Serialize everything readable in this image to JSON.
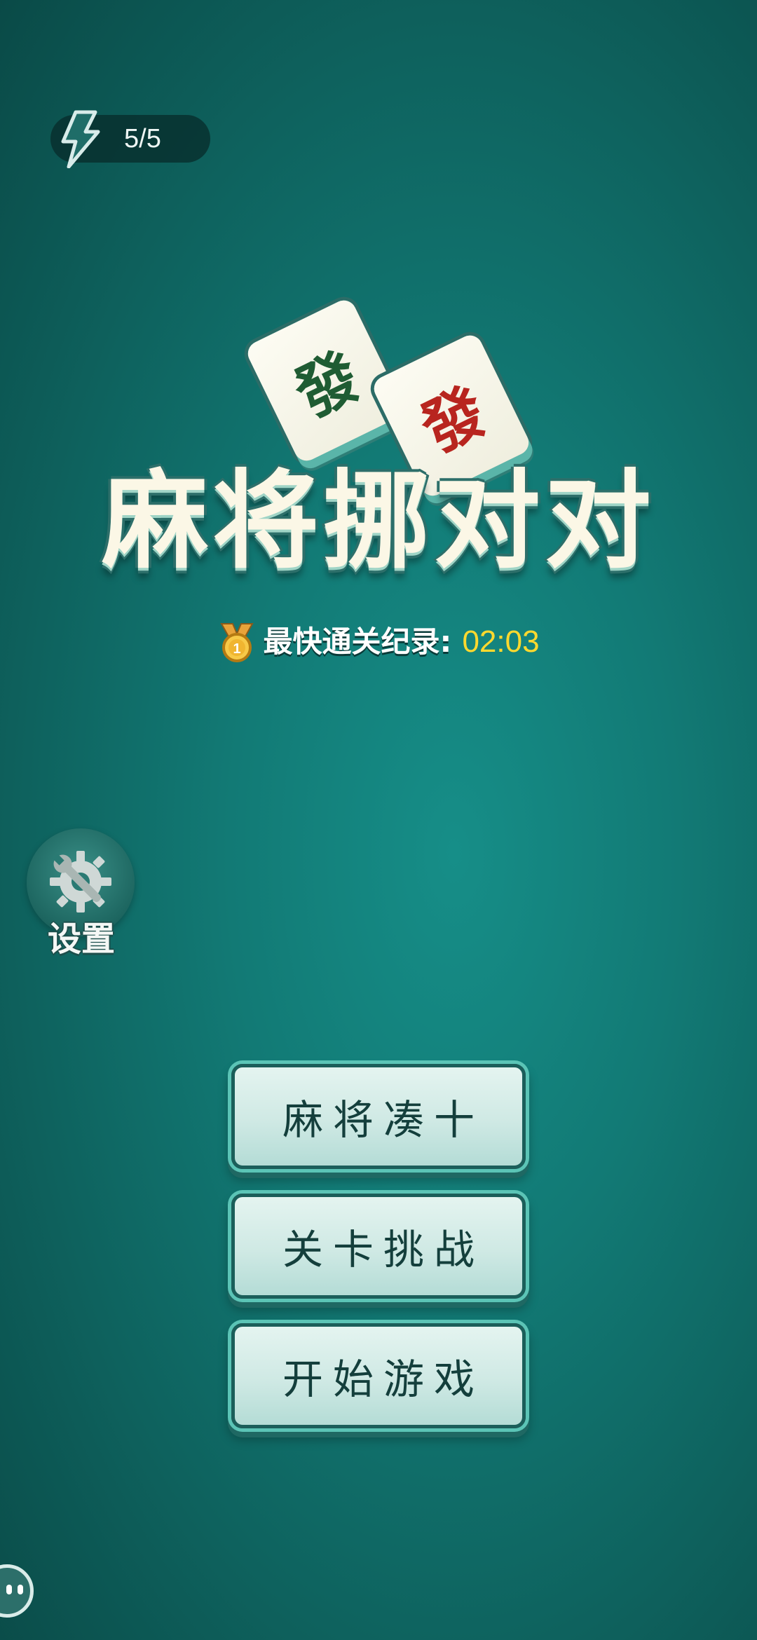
{
  "energy": {
    "icon": "lightning-icon",
    "value": "5/5"
  },
  "logo": {
    "tile_1_glyph": "發",
    "tile_2_glyph": "發",
    "title": "麻将挪对对",
    "colors": {
      "tile_1_glyph": "#1f5c33",
      "tile_2_glyph": "#b8251f"
    }
  },
  "record": {
    "icon": "medal-icon",
    "medal_number": "1",
    "label": "最快通关纪录:",
    "time": "02:03",
    "time_color": "#ffd92e"
  },
  "settings": {
    "icon": "gear-wrench-icon",
    "label": "设置"
  },
  "menu": {
    "buttons": [
      {
        "label": "麻将凑十"
      },
      {
        "label": "关卡挑战"
      },
      {
        "label": "开始游戏"
      }
    ]
  },
  "floating_button": {
    "icon": "assistant-face-icon"
  },
  "theme": {
    "background": "#127a75",
    "accent": "#5bc4b6"
  }
}
